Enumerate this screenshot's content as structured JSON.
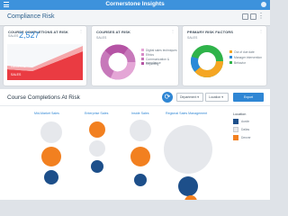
{
  "app": {
    "title": "Cornerstone Insights"
  },
  "header": {
    "title": "Compliance Risk"
  },
  "cards": {
    "completions": {
      "title": "COURSE COMPLETIONS AT RISK",
      "label": "SALES",
      "value": "2,527",
      "bar_label": "GENERAL",
      "bar_label2": "SALES"
    },
    "courses": {
      "title": "COURSES AT RISK",
      "label": "SALES",
      "legend": [
        "Digital sales techniques",
        "Ethics",
        "Communication & compliance",
        "Reporting"
      ]
    },
    "risk_factors": {
      "title": "PRIMARY RISK FACTORS",
      "label": "SALES",
      "legend": [
        "Out of due date",
        "Manager intervention",
        "Behavior"
      ]
    }
  },
  "main": {
    "title": "Course Completions At Risk",
    "department_label": "Department",
    "location_label": "Location",
    "export_label": "Export",
    "columns": [
      "Mid-Market Sales",
      "Enterprise Sales",
      "Inside Sales",
      "Regional Sales Management"
    ],
    "legend_title": "Location",
    "legend": [
      {
        "name": "Austin",
        "color": "#1d4f8a"
      },
      {
        "name": "Dallas",
        "color": "#e8e8ea"
      },
      {
        "name": "Denver",
        "color": "#f28020"
      }
    ]
  }
}
